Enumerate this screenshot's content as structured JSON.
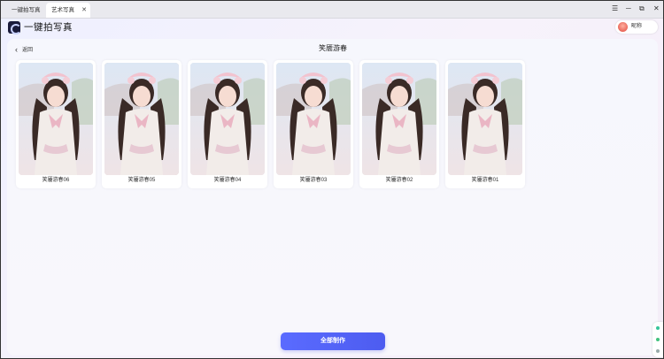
{
  "tabs": [
    {
      "label": "一键拍写真",
      "active": false
    },
    {
      "label": "艺术写真",
      "active": true,
      "close": "✕"
    }
  ],
  "window_controls": {
    "menu": "☰",
    "minimize": "─",
    "maximize": "⧉",
    "close": "✕"
  },
  "app": {
    "title": "一键拍写真"
  },
  "user": {
    "name": "昵称"
  },
  "nav": {
    "back_label": "返回",
    "back_icon": "‹"
  },
  "page": {
    "title": "笑靥游春"
  },
  "cards": [
    {
      "label": "笑靥游春06",
      "bg": "#e6d9d8"
    },
    {
      "label": "笑靥游春05",
      "bg": "#d9c8c4"
    },
    {
      "label": "笑靥游春04",
      "bg": "#dfe3ea"
    },
    {
      "label": "笑靥游春03",
      "bg": "#dbe2ec"
    },
    {
      "label": "笑靥游春02",
      "bg": "#dfe8df"
    },
    {
      "label": "笑靥游春01",
      "bg": "#e3e6ee"
    }
  ],
  "actions": {
    "make_all": "全部制作"
  },
  "colors": {
    "accent": "#5563f7",
    "panel": "#f6f7fd"
  }
}
